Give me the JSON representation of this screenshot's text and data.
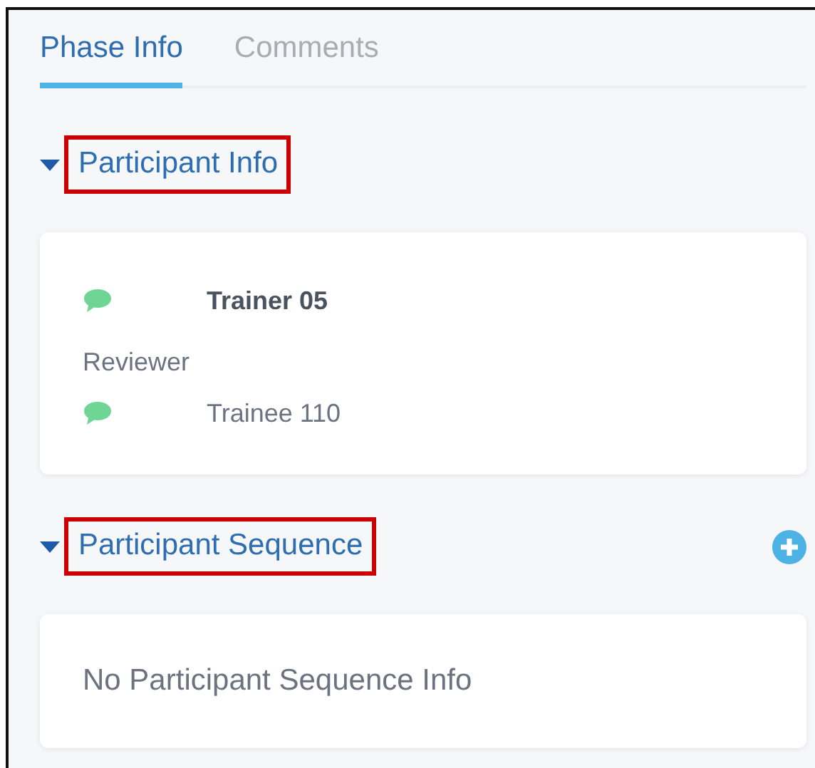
{
  "tabs": [
    {
      "label": "Phase Info",
      "selected": true
    },
    {
      "label": "Comments",
      "selected": false
    }
  ],
  "sections": [
    {
      "title": "Participant Info",
      "expanded": true,
      "highlighted": true,
      "items": [
        {
          "kind": "participant",
          "name": "Trainer 05",
          "bold": true
        },
        {
          "kind": "role",
          "text": "Reviewer"
        },
        {
          "kind": "participant",
          "name": "Trainee 110",
          "bold": false
        }
      ]
    },
    {
      "title": "Participant Sequence",
      "expanded": true,
      "highlighted": true,
      "add_button": true,
      "items": [
        {
          "kind": "empty",
          "text": "No Participant Sequence Info"
        }
      ]
    }
  ]
}
